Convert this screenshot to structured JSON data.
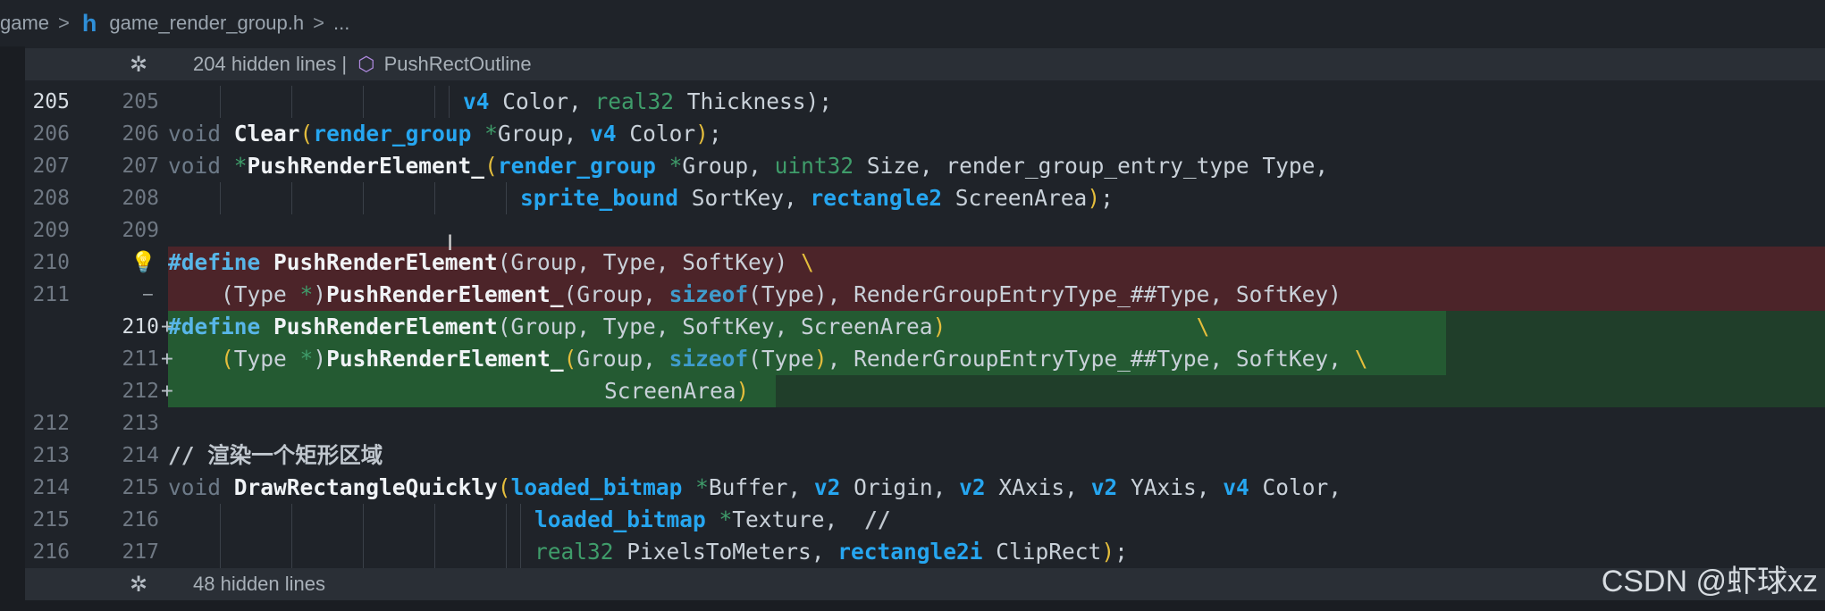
{
  "breadcrumb": {
    "root": "game",
    "file": "game_render_group.h",
    "more": "..."
  },
  "fold_top": {
    "text": "204 hidden lines",
    "separator": "|",
    "symbol": "PushRectOutline"
  },
  "fold_bottom": {
    "text": "48 hidden lines"
  },
  "lines": [
    {
      "old": "205",
      "new": "205",
      "code": "v4 Color, real32 Thickness);"
    },
    {
      "old": "206",
      "new": "206",
      "code": "void Clear(render_group *Group, v4 Color);"
    },
    {
      "old": "207",
      "new": "207",
      "code": "void *PushRenderElement_(render_group *Group, uint32 Size, render_group_entry_type Type,"
    },
    {
      "old": "208",
      "new": "208",
      "code": "sprite_bound SortKey, rectangle2 ScreenArea);"
    },
    {
      "old": "209",
      "new": "209",
      "code": ""
    },
    {
      "old": "210",
      "new": "",
      "code": "#define PushRenderElement(Group, Type, SoftKey) \\"
    },
    {
      "old": "211",
      "new": "",
      "code": "(Type *)PushRenderElement_(Group, sizeof(Type), RenderGroupEntryType_##Type, SoftKey)"
    },
    {
      "old": "",
      "new": "210",
      "code": "#define PushRenderElement(Group, Type, SoftKey, ScreenArea) \\"
    },
    {
      "old": "",
      "new": "211",
      "code": "(Type *)PushRenderElement_(Group, sizeof(Type), RenderGroupEntryType_##Type, SoftKey, \\"
    },
    {
      "old": "",
      "new": "212",
      "code": "ScreenArea)"
    },
    {
      "old": "212",
      "new": "213",
      "code": ""
    },
    {
      "old": "213",
      "new": "214",
      "code": "// 渲染一个矩形区域"
    },
    {
      "old": "214",
      "new": "215",
      "code": "void DrawRectangleQuickly(loaded_bitmap *Buffer, v2 Origin, v2 XAxis, v2 YAxis, v4 Color,"
    },
    {
      "old": "215",
      "new": "216",
      "code": "loaded_bitmap *Texture,  //"
    },
    {
      "old": "216",
      "new": "217",
      "code": "real32 PixelsToMeters, rectangle2i ClipRect);"
    }
  ],
  "markers": {
    "del": "—",
    "add": "+"
  },
  "watermark": "CSDN @虾球xz",
  "colors": {
    "background": "#1f2329",
    "deleted_line": "#4c2429",
    "added_line": "#203e2a",
    "added_highlight": "#245a32",
    "type_blue": "#26a6f0",
    "paren_yellow": "#e4bd3c"
  }
}
